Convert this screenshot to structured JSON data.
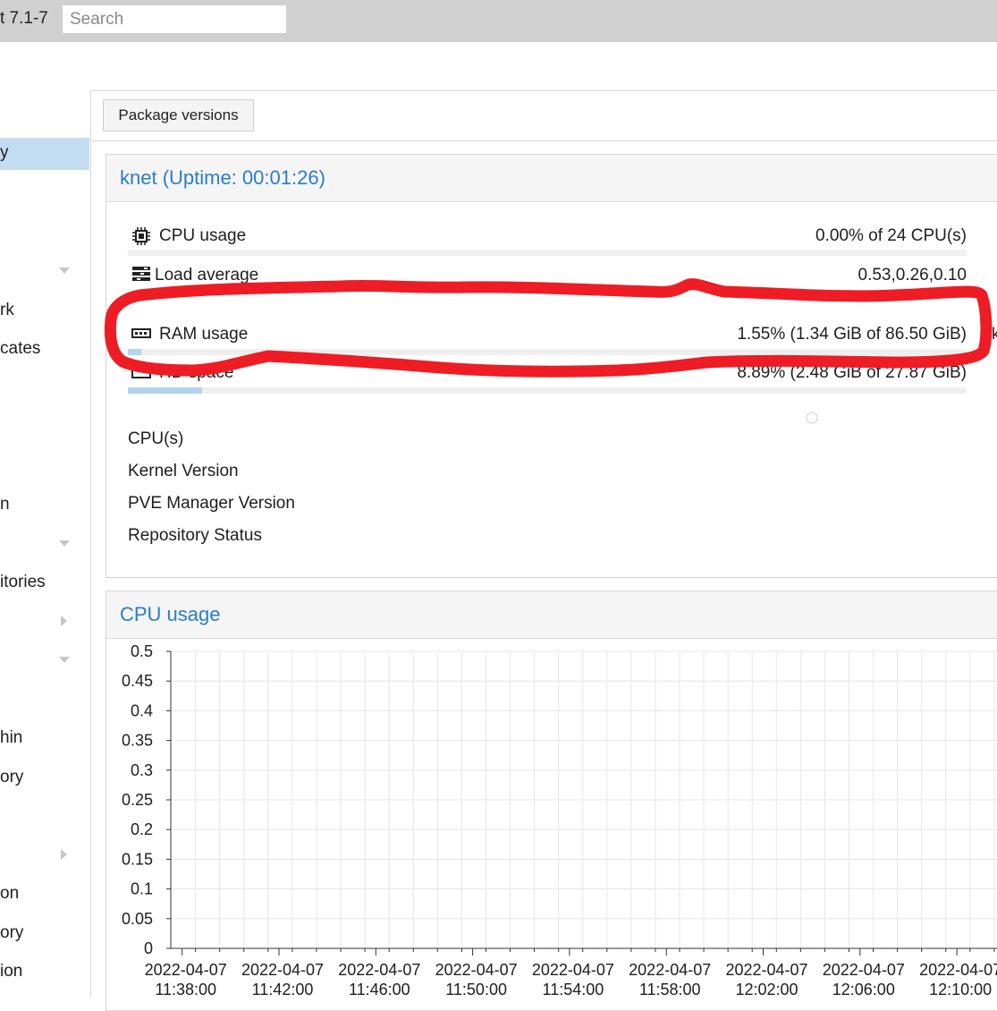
{
  "header": {
    "version": "t 7.1-7",
    "search_placeholder": "Search"
  },
  "sidebar": {
    "items": [
      {
        "label": "y"
      },
      {
        "label": "rk"
      },
      {
        "label": "cates"
      },
      {
        "label": "n"
      },
      {
        "label": "itories"
      },
      {
        "label": "hin"
      },
      {
        "label": "ory"
      },
      {
        "label": "on"
      },
      {
        "label": "ory"
      },
      {
        "label": "ion"
      }
    ]
  },
  "toolbar": {
    "package_versions_label": "Package versions"
  },
  "status_panel": {
    "title": "knet (Uptime: 00:01:26)",
    "stats": [
      {
        "label": "CPU usage",
        "value": "0.00% of 24 CPU(s)",
        "fraction": 0.0,
        "icon": "cpu-icon"
      },
      {
        "label": "Load average",
        "value": "0.53,0.26,0.10",
        "icon": "load-icon"
      },
      {
        "label": "RAM usage",
        "value": "1.55% (1.34 GiB of 86.50 GiB)",
        "fraction": 0.0155,
        "icon": "memory-icon"
      },
      {
        "label": "HD space",
        "value": "8.89% (2.48 GiB of 27.87 GiB)",
        "fraction": 0.0889,
        "icon": "hdd-icon"
      }
    ],
    "info_rows": [
      {
        "label": "CPU(s)"
      },
      {
        "label": "Kernel Version"
      },
      {
        "label": "PVE Manager Version"
      },
      {
        "label": "Repository Status"
      }
    ],
    "edge_marks": [
      "k"
    ]
  },
  "annotation": {
    "color": "#ee1c24",
    "shape": "freehand-outline",
    "target": "RAM usage"
  },
  "cpu_panel": {
    "title": "CPU usage"
  },
  "chart_data": {
    "type": "line",
    "title": "CPU usage",
    "y_ticks": [
      "0",
      "0.05",
      "0.1",
      "0.15",
      "0.2",
      "0.25",
      "0.3",
      "0.35",
      "0.4",
      "0.45",
      "0.5"
    ],
    "ylim": [
      0,
      0.5
    ],
    "x_ticks": [
      {
        "date": "2022-04-07",
        "time": "11:38:00"
      },
      {
        "date": "2022-04-07",
        "time": "11:42:00"
      },
      {
        "date": "2022-04-07",
        "time": "11:46:00"
      },
      {
        "date": "2022-04-07",
        "time": "11:50:00"
      },
      {
        "date": "2022-04-07",
        "time": "11:54:00"
      },
      {
        "date": "2022-04-07",
        "time": "11:58:00"
      },
      {
        "date": "2022-04-07",
        "time": "12:02:00"
      },
      {
        "date": "2022-04-07",
        "time": "12:06:00"
      },
      {
        "date": "2022-04-07",
        "time": "12:10:00"
      }
    ],
    "grid": true,
    "series": []
  }
}
